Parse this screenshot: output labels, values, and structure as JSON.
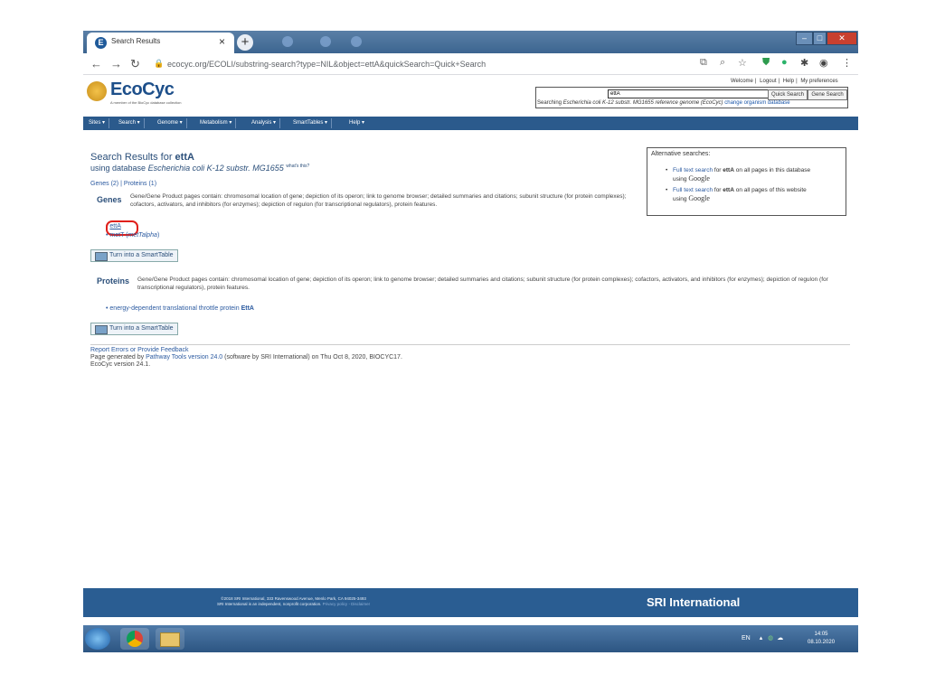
{
  "browser": {
    "tab_title": "Search Results",
    "tab_close": "×",
    "new_tab": "+",
    "url": "ecocyc.org/ECOLI/substring-search?type=NIL&object=ettA&quickSearch=Quick+Search",
    "icons": [
      "back-icon",
      "forward-icon",
      "reload-icon",
      "lock-icon",
      "translate-icon",
      "zoom-icon",
      "star-icon",
      "extension-icon",
      "profile-icon",
      "menu-icon"
    ]
  },
  "header": {
    "logo": "EcoCyc",
    "logo_sub": "A member of the BioCyc database collection",
    "links": [
      "Welcome",
      "Logout",
      "Help",
      "My preferences"
    ],
    "search_value": "ettA",
    "quick_search": "Quick Search",
    "gene_search": "Gene Search",
    "searching_prefix": "Searching",
    "searching_db": "Escherichia coli K-12 substr. MG1655 reference genome (EcoCyc)",
    "change_db": "change organism database"
  },
  "menu": [
    "Sites ▾",
    "Search ▾",
    "Genome ▾",
    "Metabolism ▾",
    "Analysis ▾",
    "SmartTables ▾",
    "Help ▾"
  ],
  "results": {
    "title_prefix": "Search Results for ",
    "query": "ettA",
    "db_prefix": "using database ",
    "db_name": "Escherichia coli K-12 substr. MG1655",
    "whats_this": "what's this?",
    "genes_count": "Genes (2)",
    "proteins_count": "Proteins (1)",
    "sep": " | ",
    "genes_label": "Genes",
    "genes_desc": "Gene/Gene Product pages contain: chromosomal location of gene; depiction of its operon; link to genome browser; detailed summaries and citations; subunit structure (for protein complexes); cofactors, activators, and inhibitors (for enzymes); depiction of regulon (for transcriptional regulators), protein features.",
    "gene_1": "ettA",
    "gene_2_prefix": "metT (",
    "gene_2_italic": "metTalpha",
    "gene_2_suffix": ")",
    "smarttable": "Turn into a SmartTable",
    "proteins_label": "Proteins",
    "proteins_desc": "Gene/Gene Product pages contain: chromosomal location of gene; depiction of its operon; link to genome browser; detailed summaries and citations; subunit structure (for protein complexes); cofactors, activators, and inhibitors (for enzymes); depiction of regulon (for transcriptional regulators), protein features.",
    "protein_1_prefix": "energy-dependent translational throttle protein ",
    "protein_1_name": "EttA"
  },
  "alt": {
    "heading": "Alternative searches:",
    "item1_link": "Full text search",
    "item1_mid": " for ",
    "item1_term": "ettA",
    "item1_rest": " on all pages in this database",
    "using": "using ",
    "google": "Google",
    "item2_link": "Full text search",
    "item2_mid": " for ",
    "item2_term": "ettA",
    "item2_rest": " on all pages of this website"
  },
  "footer": {
    "report": "Report Errors or Provide Feedback",
    "gen_prefix": "Page generated by ",
    "pathway_tools": "Pathway Tools version 24.0",
    "gen_rest": " (software by SRI International) on Thu Oct 8, 2020, BIOCYC17.",
    "version": "EcoCyc version 24.1."
  },
  "sri": {
    "line1": "©2018 SRI International, 333 Ravenswood Avenue, Menlo Park, CA 94025-3493",
    "line2": "SRI International is an independent, nonprofit corporation.",
    "privacy": "Privacy policy",
    "disclaimer": "Disclaimer",
    "brand": "SRI International"
  },
  "taskbar": {
    "lang": "EN",
    "time": "14:05",
    "date": "08.10.2020"
  }
}
